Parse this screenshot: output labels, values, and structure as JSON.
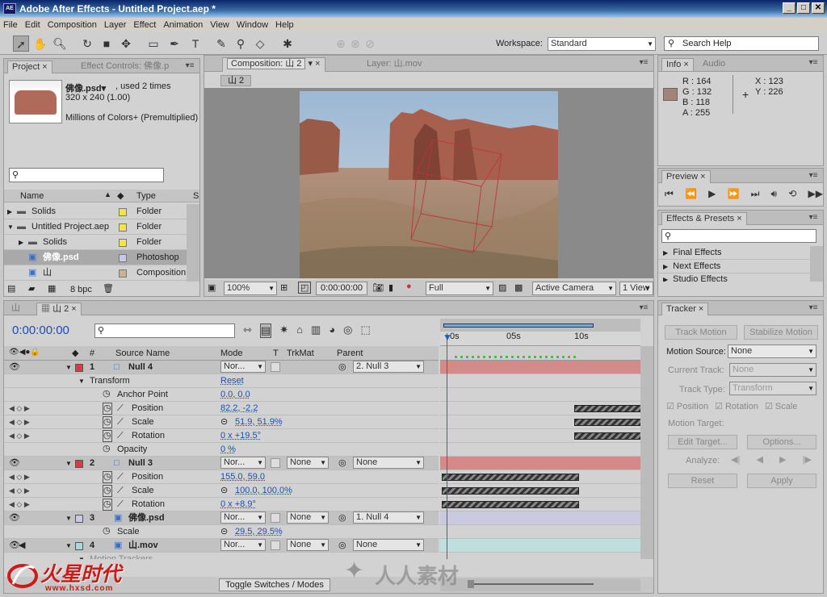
{
  "app": {
    "title": "Adobe After Effects - Untitled Project.aep *",
    "icon": "AE"
  },
  "menu": [
    "File",
    "Edit",
    "Composition",
    "Layer",
    "Effect",
    "Animation",
    "View",
    "Window",
    "Help"
  ],
  "workspace": {
    "label": "Workspace:",
    "value": "Standard"
  },
  "search_help": "Search Help",
  "project": {
    "tab": "Project",
    "tab2": "Effect Controls: 佛像.p",
    "item_name": "佛像.psd▾",
    "used": ", used 2 times",
    "dims": "320 x 240 (1.00)",
    "colors": "Millions of Colors+ (Premultiplied)",
    "col_name": "Name",
    "col_type": "Type",
    "col_s": "S",
    "rows": [
      {
        "name": "Solids",
        "type": "Folder",
        "indent": 0,
        "color": "#f2e34a"
      },
      {
        "name": "Untitled Project.aep",
        "type": "Folder",
        "indent": 0,
        "color": "#f2e34a"
      },
      {
        "name": "Solids",
        "type": "Folder",
        "indent": 1,
        "color": "#f2e34a"
      },
      {
        "name": "佛像.psd",
        "type": "Photoshop",
        "indent": 1,
        "color": "#c8c8e8"
      },
      {
        "name": "山",
        "type": "Composition",
        "indent": 1,
        "color": "#c9b491"
      }
    ],
    "bpc": "8 bpc"
  },
  "comp": {
    "tab": "Composition: 山 2",
    "layer_tab": "Layer: 山.mov",
    "subtab": "山 2",
    "zoom": "100%",
    "timecode": "0:00:00:00",
    "quality": "Full",
    "camera": "Active Camera",
    "views": "1 View"
  },
  "info": {
    "tab": "Info",
    "tab2": "Audio",
    "r": "R : 164",
    "g": "G : 132",
    "b": "B : 118",
    "a": "A : 255",
    "x": "X : 123",
    "y": "Y : 226",
    "swatch": "#a48476"
  },
  "preview": {
    "tab": "Preview"
  },
  "effects": {
    "tab": "Effects & Presets",
    "items": [
      "Final Effects",
      "Next Effects",
      "Studio Effects"
    ]
  },
  "timeline": {
    "tab1": "山",
    "tab2": "山 2",
    "timecode": "0:00:00:00",
    "headers": {
      "source": "Source Name",
      "mode": "Mode",
      "t": "T",
      "trkmat": "TrkMat",
      "parent": "Parent",
      "num": "#"
    },
    "ruler": [
      "0s",
      "05s",
      "10s"
    ],
    "toggle": "Toggle Switches / Modes"
  },
  "layers": [
    {
      "type": "layer",
      "num": "1",
      "name": "Null 4",
      "color": "#d04040",
      "mode": "Nor...",
      "trk": "",
      "parent": "2. Null 3"
    },
    {
      "type": "group",
      "name": "Transform",
      "value": "Reset"
    },
    {
      "type": "prop",
      "name": "Anchor Point",
      "value": "0.0, 0.0",
      "sw": false
    },
    {
      "type": "prop",
      "name": "Position",
      "value": "82.2, -2.2",
      "sw": true
    },
    {
      "type": "prop",
      "name": "Scale",
      "value": "51.9, 51.9%",
      "sw": true,
      "link": true
    },
    {
      "type": "prop",
      "name": "Rotation",
      "value": "0 x +19.5°",
      "sw": true
    },
    {
      "type": "prop",
      "name": "Opacity",
      "value": "0 %",
      "sw": false
    },
    {
      "type": "layer",
      "num": "2",
      "name": "Null 3",
      "color": "#d04040",
      "mode": "Nor...",
      "trk": "None",
      "parent": "None"
    },
    {
      "type": "prop",
      "name": "Position",
      "value": "155.0, 59.0",
      "sw": true
    },
    {
      "type": "prop",
      "name": "Scale",
      "value": "100.0, 100.0%",
      "sw": true,
      "link": true
    },
    {
      "type": "prop",
      "name": "Rotation",
      "value": "0 x +8.9°",
      "sw": true
    },
    {
      "type": "layer",
      "num": "3",
      "name": "佛像.psd",
      "color": "#c8c8e8",
      "mode": "Nor...",
      "trk": "None",
      "parent": "1. Null 4"
    },
    {
      "type": "prop",
      "name": "Scale",
      "value": "29.5, 29.5%",
      "sw": false,
      "link": true
    },
    {
      "type": "layer",
      "num": "4",
      "name": "山.mov",
      "color": "#a8d8d8",
      "mode": "Nor...",
      "trk": "None",
      "parent": "None"
    },
    {
      "type": "group",
      "name": "Motion Trackers",
      "value": ""
    }
  ],
  "tracker": {
    "tab": "Tracker",
    "track_motion": "Track Motion",
    "stabilize": "Stabilize Motion",
    "motion_source_label": "Motion Source:",
    "motion_source": "None",
    "current_track_label": "Current Track:",
    "current_track": "None",
    "track_type_label": "Track Type:",
    "track_type": "Transform",
    "position": "Position",
    "rotation": "Rotation",
    "scale": "Scale",
    "motion_target": "Motion Target:",
    "edit_target": "Edit Target...",
    "options": "Options...",
    "analyze": "Analyze:",
    "reset": "Reset",
    "apply": "Apply"
  },
  "watermark": {
    "brand": "火星时代",
    "url": "www.hxsd.com",
    "brand2": "人人素材"
  }
}
